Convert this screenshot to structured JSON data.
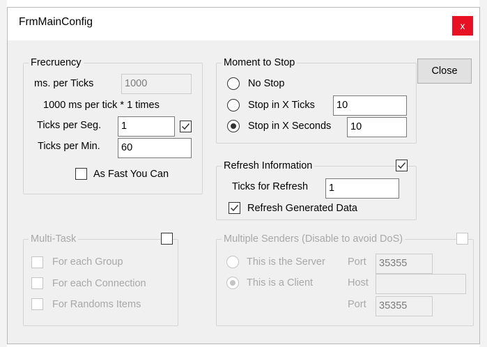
{
  "window": {
    "title": "FrmMainConfig",
    "close_glyph": "x"
  },
  "close_button": "Close",
  "frequency": {
    "legend": "Frecruency",
    "ms_label": "ms. per Ticks",
    "ms_value": "1000",
    "info": "1000 ms per tick * 1 times",
    "ticks_seg_label": "Ticks per Seg.",
    "ticks_seg_value": "1",
    "ticks_seg_checked": true,
    "ticks_min_label": "Ticks per Min.",
    "ticks_min_value": "60",
    "fast_label": "As Fast You Can",
    "fast_checked": false
  },
  "moment": {
    "legend": "Moment to Stop",
    "options": [
      {
        "label": "No Stop",
        "selected": false
      },
      {
        "label": "Stop in X Ticks",
        "value": "10",
        "selected": false
      },
      {
        "label": "Stop in X Seconds",
        "value": "10",
        "selected": true
      }
    ]
  },
  "refresh": {
    "legend": "Refresh Information",
    "enabled": true,
    "ticks_label": "Ticks for Refresh",
    "ticks_value": "1",
    "generated_label": "Refresh Generated Data",
    "generated_checked": true
  },
  "multitask": {
    "legend": "Multi-Task",
    "enabled": false,
    "items": [
      {
        "label": "For each Group",
        "checked": false
      },
      {
        "label": "For each Connection",
        "checked": false
      },
      {
        "label": "For Randoms Items",
        "checked": false
      }
    ]
  },
  "senders": {
    "legend": "Multiple Senders (Disable to avoid DoS)",
    "enabled": false,
    "server_label": "This is the Server",
    "client_label": "This is a Client",
    "client_selected": true,
    "port_label": "Port",
    "server_port": "35355",
    "host_label": "Host",
    "host_value": "",
    "client_port_label": "Port",
    "client_port": "35355"
  },
  "icons": {
    "checkmark": "check-icon",
    "close": "close-icon"
  }
}
